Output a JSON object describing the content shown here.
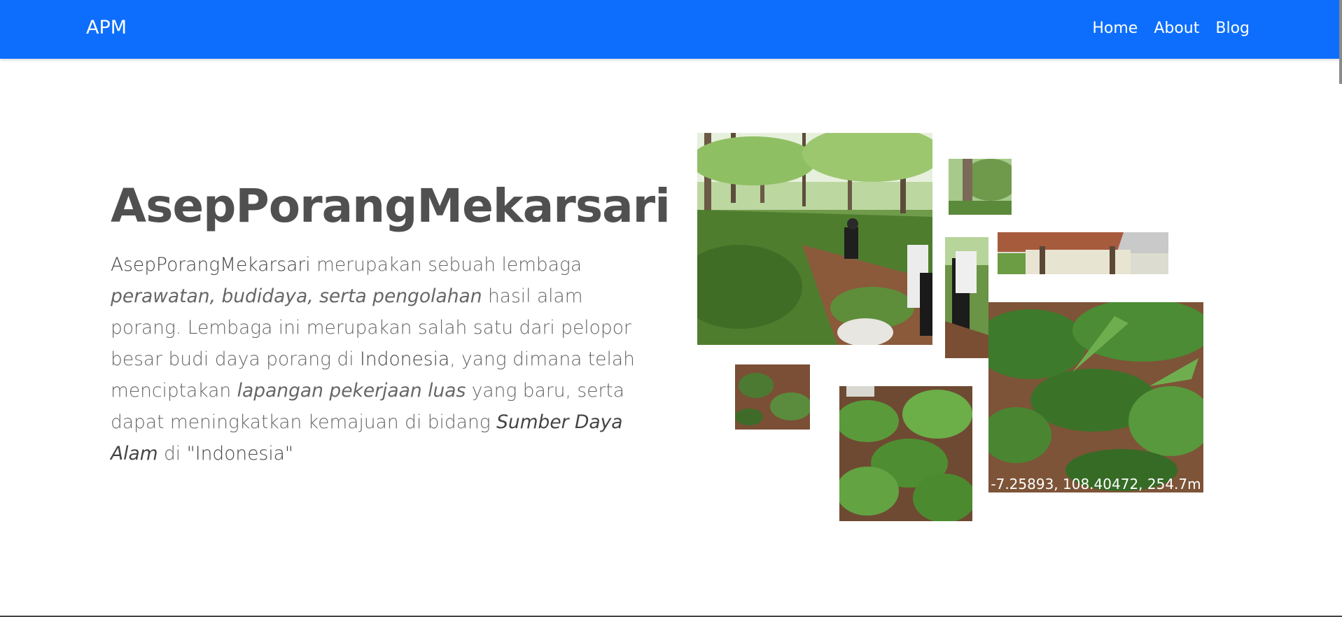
{
  "navbar": {
    "brand": "APM",
    "links": [
      "Home",
      "About",
      "Blog"
    ],
    "bg_color": "#0d6efd"
  },
  "hero": {
    "title": "AsepPorangMekarsari",
    "p1": "AsepPorangMekarsari",
    "p2": " merupakan sebuah lembaga ",
    "p3": "perawatan, budidaya, serta pengolahan",
    "p4": " hasil alam porang. Lembaga ini merupakan salah satu dari pelopor besar budi daya porang di ",
    "p5": "Indonesia",
    "p6": ", yang dimana telah menciptakan ",
    "p7": "lapangan pekerjaan luas",
    "p8": " yang baru, serta dapat meningkatkan kemajuan di bidang ",
    "p9": "Sumber Daya Alam",
    "p10": " di ",
    "p11": "\"Indonesia\""
  },
  "gallery": {
    "geo_stamp": "-7.25893, 108.40472, 254.7m"
  }
}
